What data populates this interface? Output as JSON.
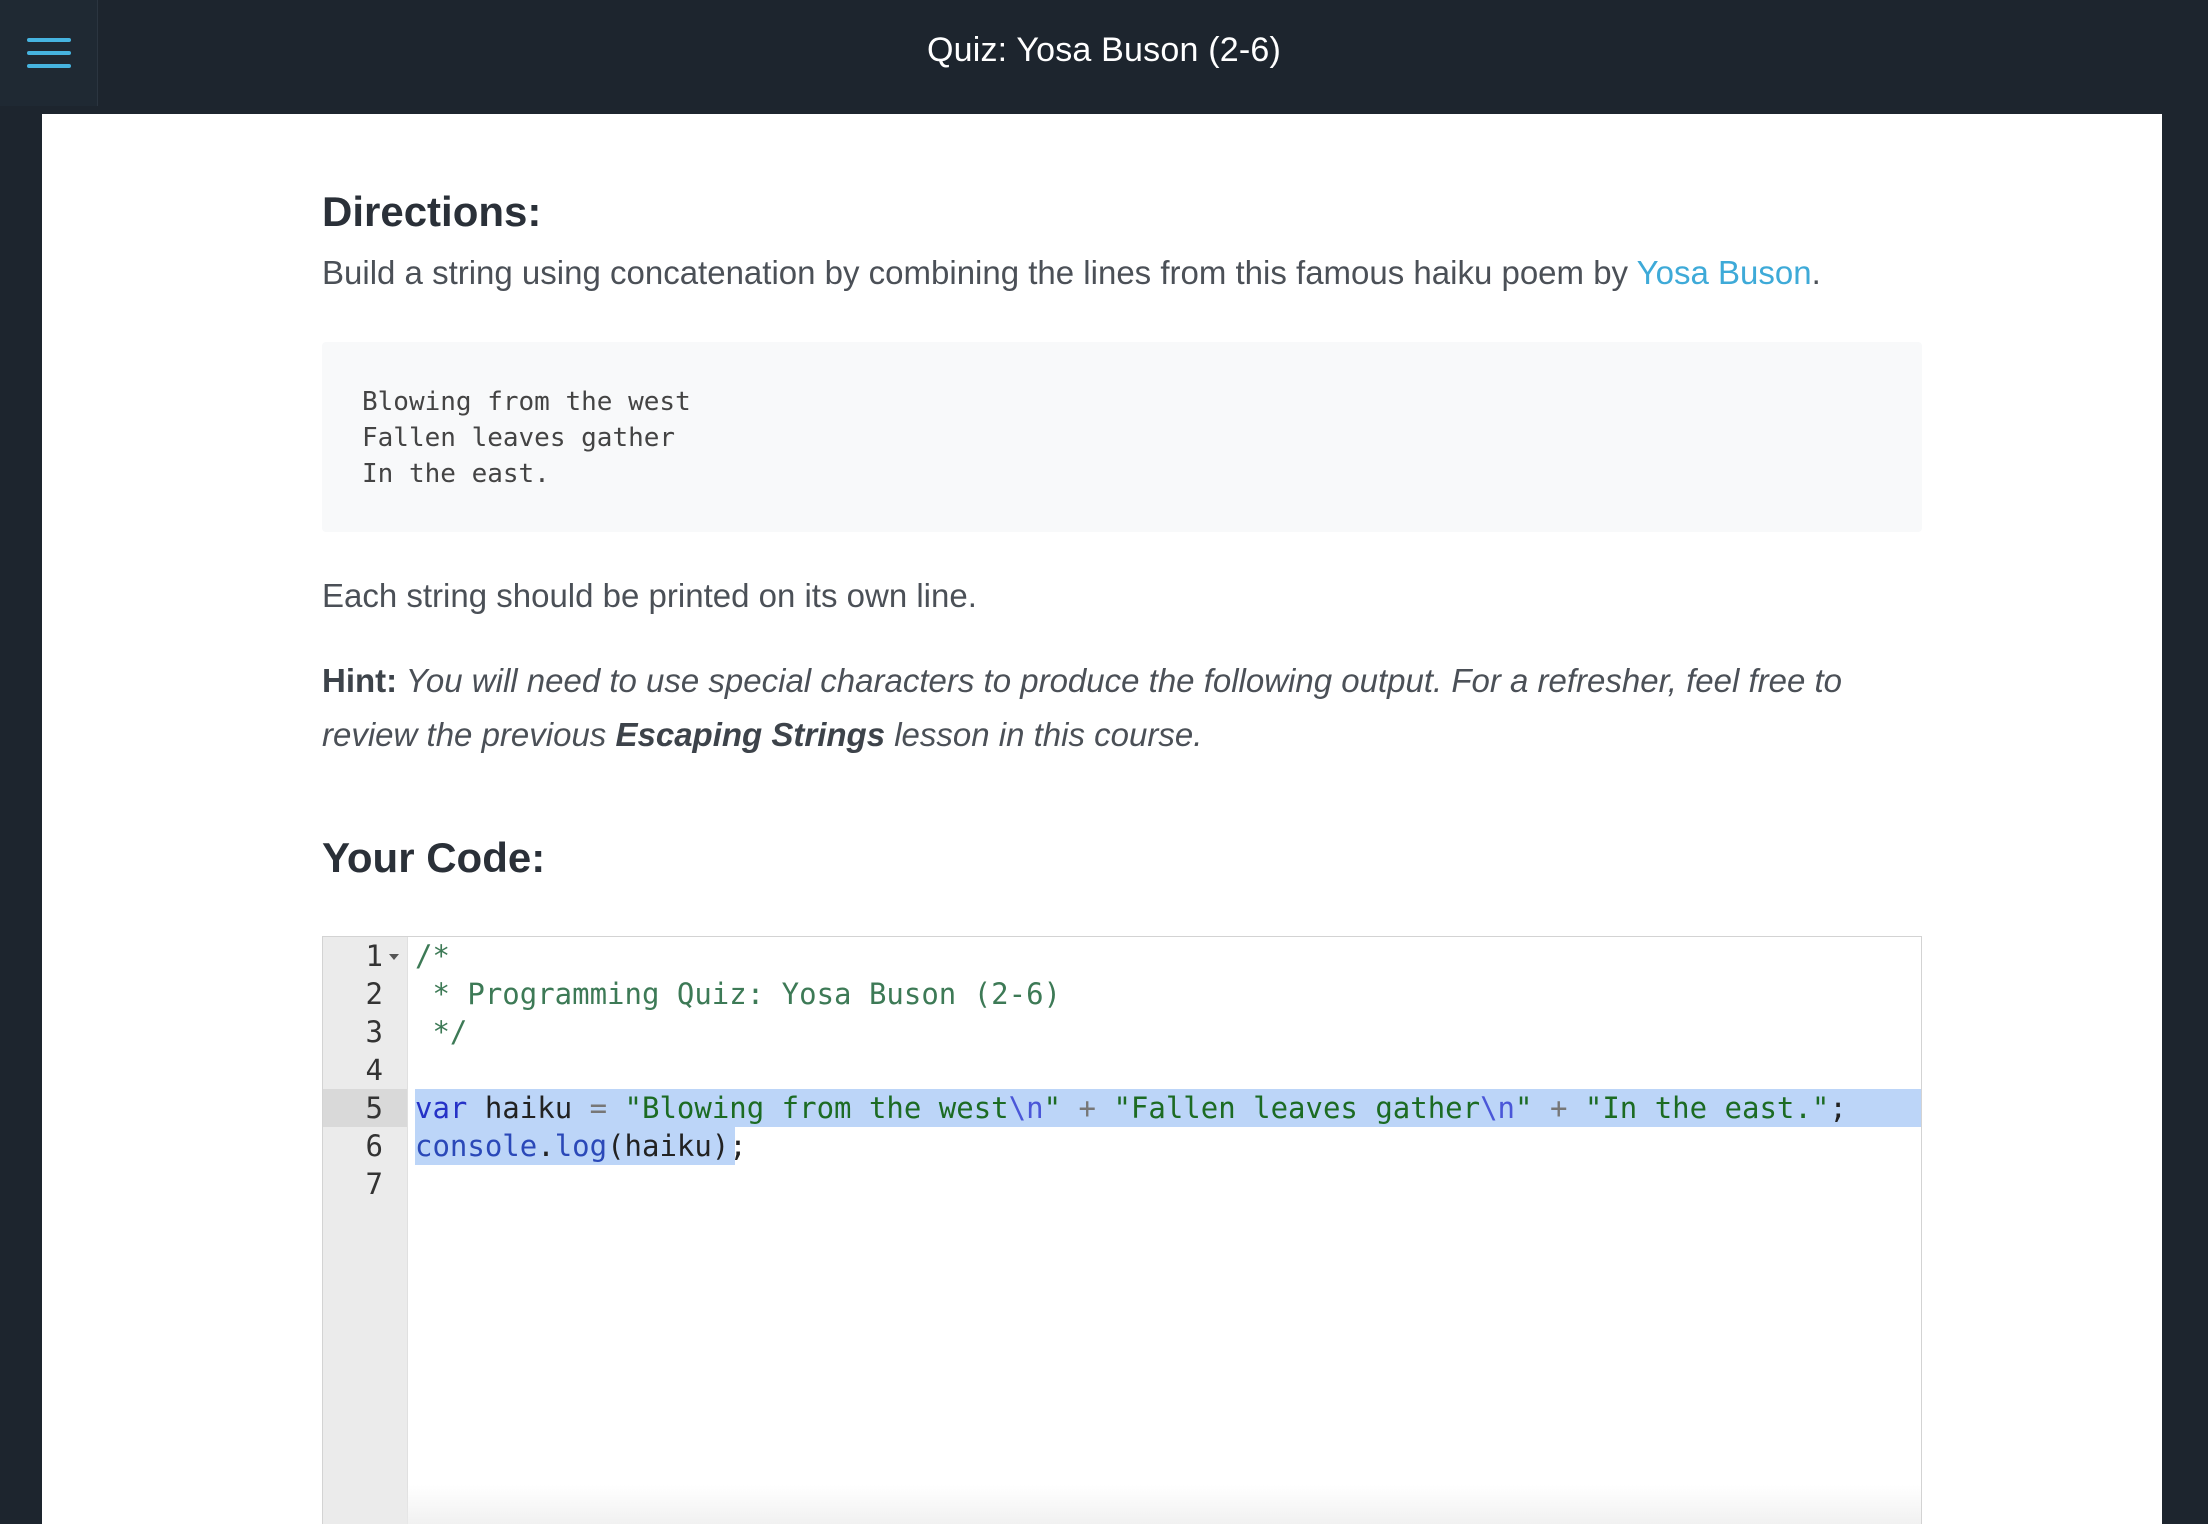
{
  "header": {
    "menu_icon": "hamburger-menu-icon",
    "title": "Quiz: Yosa Buson (2-6)"
  },
  "directions": {
    "heading": "Directions:",
    "intro_text": "Build a string using concatenation by combining the lines from this famous haiku poem by ",
    "link_text": "Yosa Buson",
    "intro_end": ".",
    "poem_lines": [
      "Blowing from the west",
      "Fallen leaves gather",
      "In the east."
    ],
    "instruction": "Each string should be printed on its own line.",
    "hint_label": "Hint:",
    "hint_text_1": " You will need to use special characters to produce the following output. For a refresher, feel free to review the previous ",
    "hint_lesson": "Escaping Strings",
    "hint_text_2": " lesson in this course."
  },
  "code_section": {
    "heading": "Your Code:",
    "line_numbers": [
      "1",
      "2",
      "3",
      "4",
      "5",
      "6",
      "7"
    ],
    "active_line": "5",
    "lines": {
      "l1": "/*",
      "l2": " * Programming Quiz: Yosa Buson (2-6)",
      "l3": " */",
      "l5_kw": "var",
      "l5_name": " haiku ",
      "l5_eq": "=",
      "l5_s1": " \"Blowing from the west",
      "l5_e1": "\\n",
      "l5_q1": "\"",
      "l5_p1": " + ",
      "l5_s2": "\"Fallen leaves gather",
      "l5_e2": "\\n",
      "l5_q2": "\"",
      "l5_p2": " + ",
      "l5_s3": "\"In the east.\"",
      "l5_end": ";",
      "l6_obj": "console",
      "l6_dot": ".",
      "l6_fn": "log",
      "l6_rest": "(haiku);"
    }
  },
  "colors": {
    "topbar": "#1d252e",
    "accent": "#46b4e0",
    "link": "#3eaad8",
    "selection": "#bcd5f8"
  }
}
